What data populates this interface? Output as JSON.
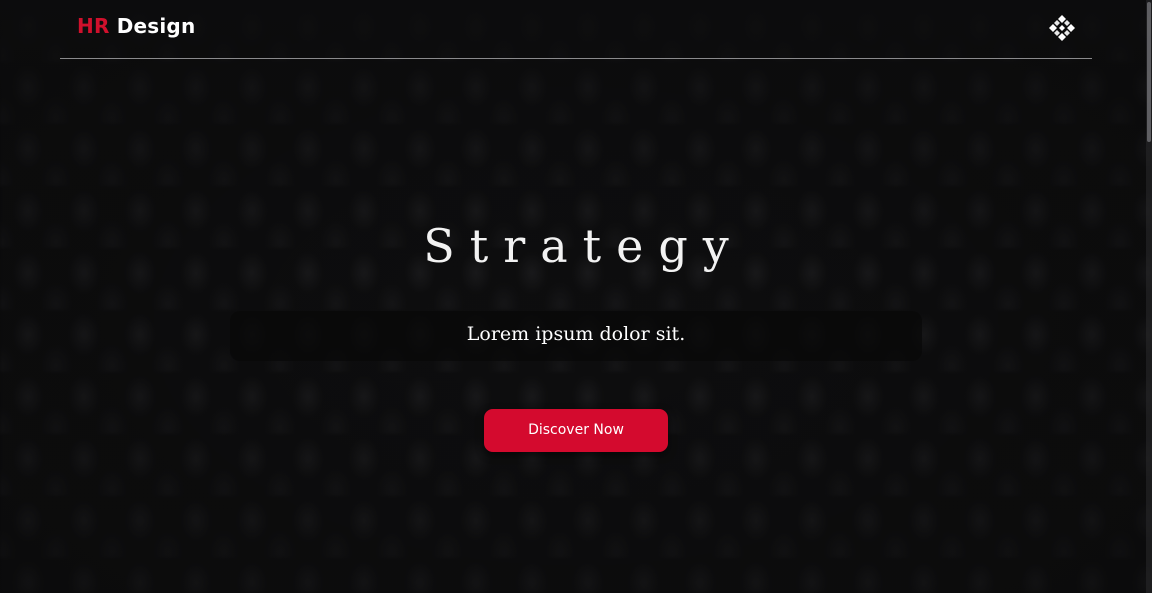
{
  "header": {
    "logo_accent": "HR",
    "logo_text": " Design"
  },
  "icons": {
    "menu": "diamond-grid-icon"
  },
  "hero": {
    "title": "Strategy",
    "subtitle": "Lorem ipsum dolor sit.",
    "cta_label": "Discover Now"
  },
  "colors": {
    "accent": "#d40a2e",
    "background": "#0e0e0f",
    "text": "#ffffff"
  }
}
